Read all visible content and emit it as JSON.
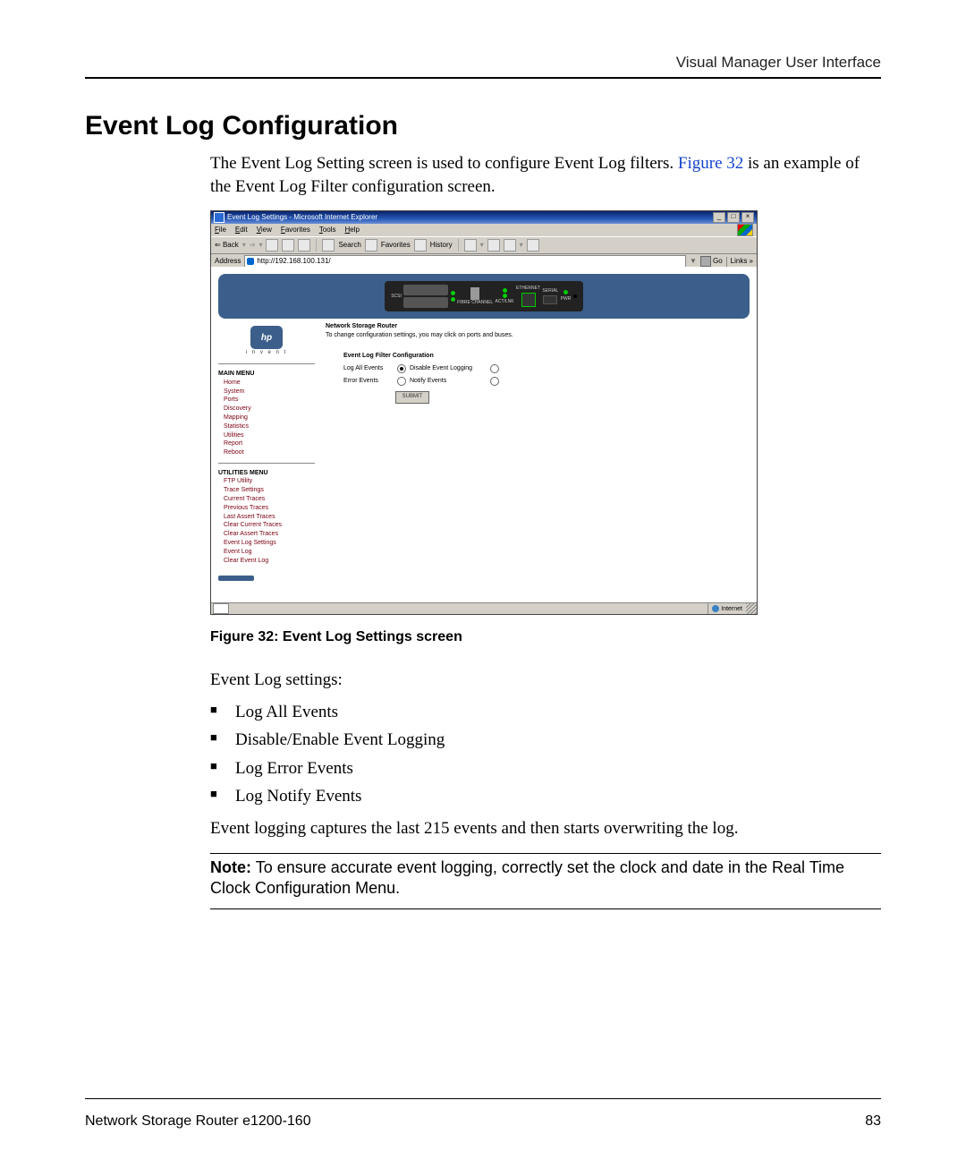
{
  "page_header": "Visual Manager User Interface",
  "section_title": "Event Log Configuration",
  "intro_pre": "The Event Log Setting screen is used to configure Event Log filters. ",
  "intro_link": "Figure 32",
  "intro_post": " is an example of the Event Log Filter configuration screen.",
  "figure_caption_prefix": "Figure 32:  ",
  "figure_caption": "Event Log Settings screen",
  "settings_intro": "Event Log settings:",
  "settings_list": [
    "Log All Events",
    "Disable/Enable Event Logging",
    "Log Error Events",
    "Log Notify Events"
  ],
  "settings_note": "Event logging captures the last 215 events and then starts overwriting the log.",
  "note_label": "Note:",
  "note_body": "To ensure accurate event logging, correctly set the clock and date in the Real Time Clock Configuration Menu.",
  "screenshot": {
    "window_title": "Event Log Settings - Microsoft Internet Explorer",
    "menus": [
      "File",
      "Edit",
      "View",
      "Favorites",
      "Tools",
      "Help"
    ],
    "toolbar": {
      "back": "Back",
      "search": "Search",
      "favorites": "Favorites",
      "history": "History"
    },
    "address_label": "Address",
    "address_value": "http://192.168.100.131/",
    "go_label": "Go",
    "links_label": "Links",
    "device_labels": {
      "scsi": "SCSI",
      "fibre": "FIBRE CHANNEL",
      "act": "ACT/LNK",
      "eth": "ETHERNET",
      "serial": "SERIAL",
      "pwr": "PWR"
    },
    "hp_logo": "hp",
    "hp_invent": "i n v e n t",
    "main_menu_hdr": "MAIN MENU",
    "main_menu": [
      "Home",
      "System",
      "Ports",
      "Discovery",
      "Mapping",
      "Statistics",
      "Utilities",
      "Report",
      "Reboot"
    ],
    "util_menu_hdr": "UTILITIES MENU",
    "util_menu": [
      "FTP Utility",
      "Trace Settings",
      "Current Traces",
      "Previous Traces",
      "Last Assert Traces",
      "Clear Current Traces",
      "Clear Assert Traces",
      "Event Log Settings",
      "Event Log",
      "Clear Event Log"
    ],
    "right_title": "Network Storage Router",
    "right_sub": "To change configuration settings, you may click on ports and buses.",
    "filter_hdr": "Event Log Filter Configuration",
    "opt_log_all": "Log All Events",
    "opt_disable": "Disable Event Logging",
    "opt_error": "Error Events",
    "opt_notify": "Notify Events",
    "submit": "SUBMIT",
    "status_zone": "Internet"
  },
  "footer_left": "Network Storage Router e1200-160",
  "footer_right": "83"
}
